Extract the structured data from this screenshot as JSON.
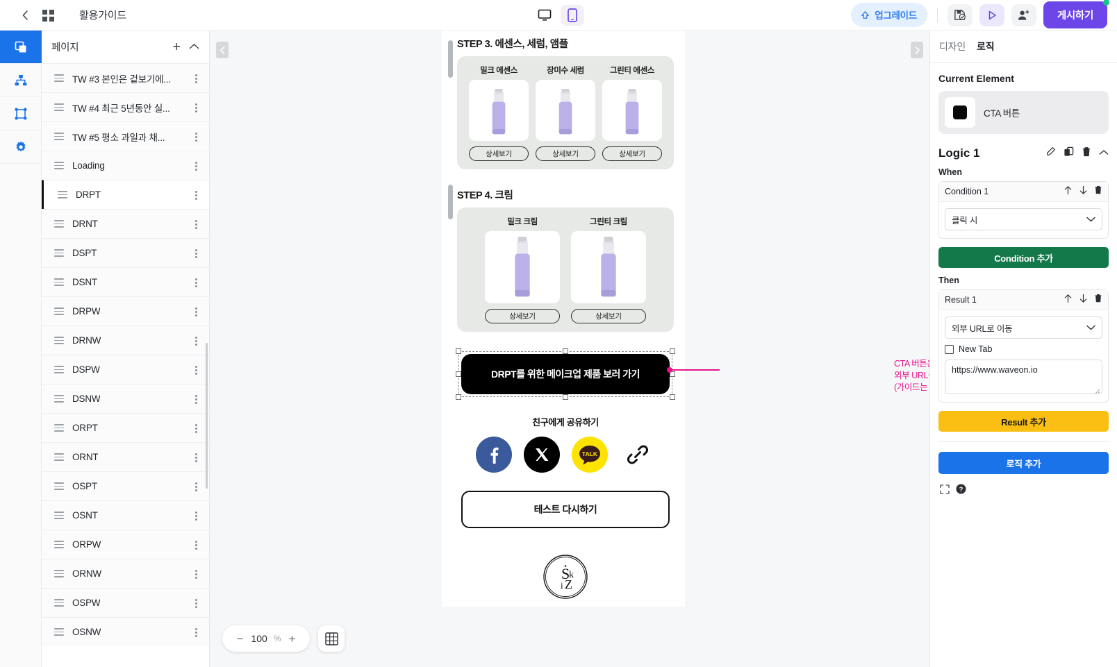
{
  "topbar": {
    "back_icon": "chevron-left-icon",
    "grid_icon": "apps-grid-icon",
    "title": "활용가이드",
    "device_desktop_icon": "desktop-icon",
    "device_mobile_icon": "mobile-icon",
    "upgrade_label": "업그레이드",
    "upgrade_icon": "upgrade-arrow-icon",
    "save_icon": "save-check-icon",
    "preview_icon": "play-icon",
    "invite_icon": "user-add-icon",
    "publish_label": "게시하기"
  },
  "rail": {
    "items": [
      {
        "name": "pages",
        "icon": "layers-icon",
        "active": true
      },
      {
        "name": "flow",
        "icon": "sitemap-icon",
        "active": false
      },
      {
        "name": "elements",
        "icon": "frame-icon",
        "active": false
      },
      {
        "name": "settings",
        "icon": "gear-icon",
        "active": false
      }
    ]
  },
  "pages_panel": {
    "title": "페이지",
    "add_label": "+",
    "collapse_icon": "chevron-up-icon",
    "items": [
      {
        "label": "TW #3 본인은 겉보기에...",
        "selected": false
      },
      {
        "label": "TW #4 최근 5년동안 실...",
        "selected": false
      },
      {
        "label": "TW #5 평소 과일과 채...",
        "selected": false
      },
      {
        "label": "Loading",
        "selected": false
      },
      {
        "label": "DRPT",
        "selected": true
      },
      {
        "label": "DRNT",
        "selected": false
      },
      {
        "label": "DSPT",
        "selected": false
      },
      {
        "label": "DSNT",
        "selected": false
      },
      {
        "label": "DRPW",
        "selected": false
      },
      {
        "label": "DRNW",
        "selected": false
      },
      {
        "label": "DSPW",
        "selected": false
      },
      {
        "label": "DSNW",
        "selected": false
      },
      {
        "label": "ORPT",
        "selected": false
      },
      {
        "label": "ORNT",
        "selected": false
      },
      {
        "label": "OSPT",
        "selected": false
      },
      {
        "label": "OSNT",
        "selected": false
      },
      {
        "label": "ORPW",
        "selected": false
      },
      {
        "label": "ORNW",
        "selected": false
      },
      {
        "label": "OSPW",
        "selected": false
      },
      {
        "label": "OSNW",
        "selected": false
      }
    ]
  },
  "canvas": {
    "collapse_left_icon": "collapse-left-icon",
    "collapse_right_icon": "collapse-right-icon",
    "zoom_minus": "−",
    "zoom_value": "100",
    "zoom_unit": "%",
    "zoom_plus": "+",
    "grid_icon": "grid-toggle-icon"
  },
  "preview": {
    "step3": {
      "title": "STEP 3. 에센스, 세럼, 앰플",
      "products": [
        {
          "name": "밀크 에센스",
          "button": "상세보기"
        },
        {
          "name": "장미수 세럼",
          "button": "상세보기"
        },
        {
          "name": "그린티 에센스",
          "button": "상세보기"
        }
      ]
    },
    "step4": {
      "title": "STEP 4. 크림",
      "products": [
        {
          "name": "밀크 크림",
          "button": "상세보기"
        },
        {
          "name": "그린티 크림",
          "button": "상세보기"
        }
      ]
    },
    "cta_label": "DRPT를 위한 메이크업 제품 보러 가기",
    "annotation": "CTA 버튼은 카피라이팅 변경과 외부 URL을 추가가 가능해요. (가이드는 게시 전 삭제)",
    "annotation_lines": [
      "CTA 버튼은 카피라이팅 변경과",
      "외부 URL을 추가가 가능해요.",
      "(가이드는 게시 전 삭제)"
    ],
    "share_title": "친구에게 공유하기",
    "share_icons": [
      "facebook-icon",
      "x-twitter-icon",
      "kakaotalk-icon",
      "link-icon"
    ],
    "retry_label": "테스트 다시하기",
    "brand_logo": "skiz-circle-logo"
  },
  "right_panel": {
    "tabs": [
      {
        "label": "디자인",
        "active": false
      },
      {
        "label": "로직",
        "active": true
      }
    ],
    "current_element_label": "Current Element",
    "current_element_name": "CTA 버튼",
    "logic_title": "Logic 1",
    "logic_icons": [
      "edit-icon",
      "duplicate-icon",
      "trash-icon",
      "chevron-up-icon"
    ],
    "when_label": "When",
    "condition_name": "Condition 1",
    "condition_actions": [
      "arrow-up-icon",
      "arrow-down-icon",
      "trash-icon"
    ],
    "condition_value": "클릭 시",
    "add_condition_label": "Condition 추가",
    "then_label": "Then",
    "result_name": "Result 1",
    "result_actions": [
      "arrow-up-icon",
      "arrow-down-icon",
      "trash-icon"
    ],
    "result_action_value": "외부 URL로 이동",
    "new_tab_label": "New Tab",
    "new_tab_checked": false,
    "url_value": "https://www.waveon.io",
    "add_result_label": "Result 추가",
    "add_logic_label": "로직 추가",
    "footer_icons": [
      "fullscreen-icon",
      "help-icon"
    ]
  },
  "colors": {
    "accent_blue": "#1a73e8",
    "publish_purple": "#6c46e8",
    "green": "#13784a",
    "yellow": "#fbbf13",
    "annotation_pink": "#e6138b"
  }
}
